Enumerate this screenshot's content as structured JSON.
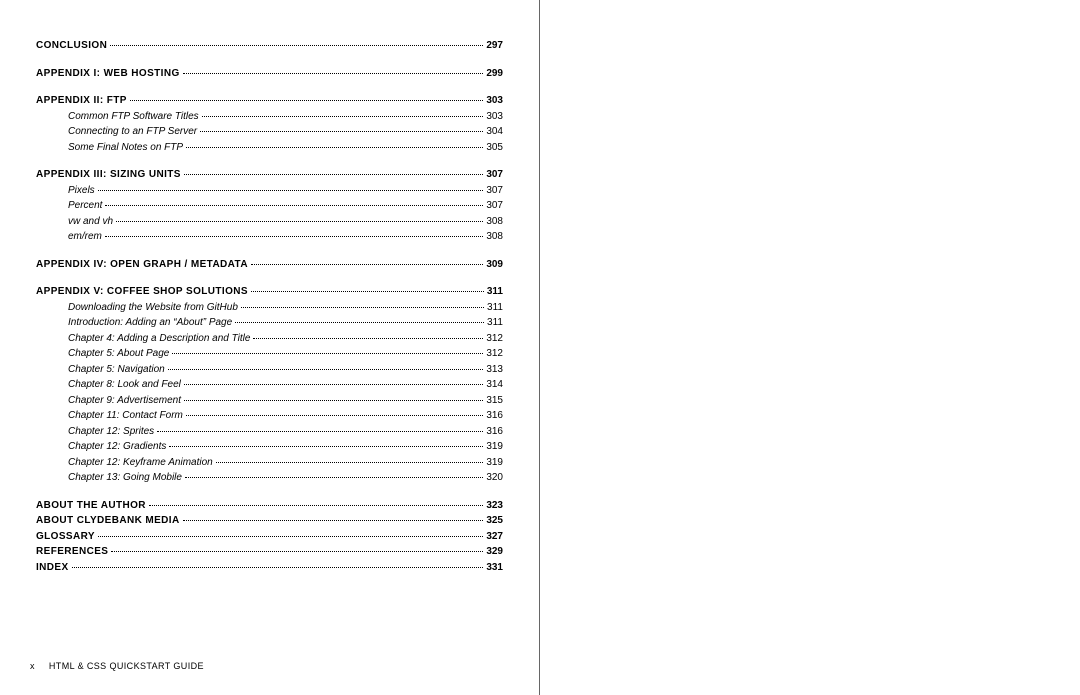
{
  "footer": {
    "page_number": "x",
    "book_title": "HTML & CSS QUICKSTART GUIDE"
  },
  "sections": [
    {
      "title": "CONCLUSION",
      "page": "297",
      "subs": []
    },
    {
      "title": "APPENDIX I: WEB HOSTING",
      "page": "299",
      "subs": []
    },
    {
      "title": "APPENDIX II: FTP",
      "page": "303",
      "subs": [
        {
          "title": "Common FTP Software Titles",
          "page": "303"
        },
        {
          "title": "Connecting to an FTP Server",
          "page": "304"
        },
        {
          "title": "Some Final Notes on FTP",
          "page": "305"
        }
      ]
    },
    {
      "title": "APPENDIX III: SIZING UNITS",
      "page": "307",
      "subs": [
        {
          "title": "Pixels",
          "page": "307"
        },
        {
          "title": "Percent",
          "page": "307"
        },
        {
          "title": "vw and vh",
          "page": "308"
        },
        {
          "title": "em/rem",
          "page": "308"
        }
      ]
    },
    {
      "title": "APPENDIX IV: OPEN GRAPH / METADATA",
      "page": "309",
      "subs": []
    },
    {
      "title": "APPENDIX V: COFFEE SHOP SOLUTIONS",
      "page": "311",
      "subs": [
        {
          "title": "Downloading the Website from GitHub",
          "page": "311"
        },
        {
          "title": "Introduction: Adding an “About” Page",
          "page": "311"
        },
        {
          "title": "Chapter 4: Adding a Description and Title",
          "page": "312"
        },
        {
          "title": "Chapter 5: About Page",
          "page": "312"
        },
        {
          "title": "Chapter 5: Navigation",
          "page": "313"
        },
        {
          "title": "Chapter 8: Look and Feel",
          "page": "314"
        },
        {
          "title": "Chapter 9: Advertisement",
          "page": "315"
        },
        {
          "title": "Chapter 11: Contact Form",
          "page": "316"
        },
        {
          "title": "Chapter 12: Sprites",
          "page": "316"
        },
        {
          "title": "Chapter 12: Gradients",
          "page": "319"
        },
        {
          "title": "Chapter 12: Keyframe Animation",
          "page": "319"
        },
        {
          "title": "Chapter 13: Going Mobile",
          "page": "320"
        }
      ]
    }
  ],
  "end_sections": [
    {
      "title": "ABOUT THE AUTHOR",
      "page": "323"
    },
    {
      "title": "ABOUT CLYDEBANK MEDIA",
      "page": "325"
    },
    {
      "title": "GLOSSARY",
      "page": "327"
    },
    {
      "title": "REFERENCES",
      "page": "329"
    },
    {
      "title": "INDEX",
      "page": "331"
    }
  ]
}
